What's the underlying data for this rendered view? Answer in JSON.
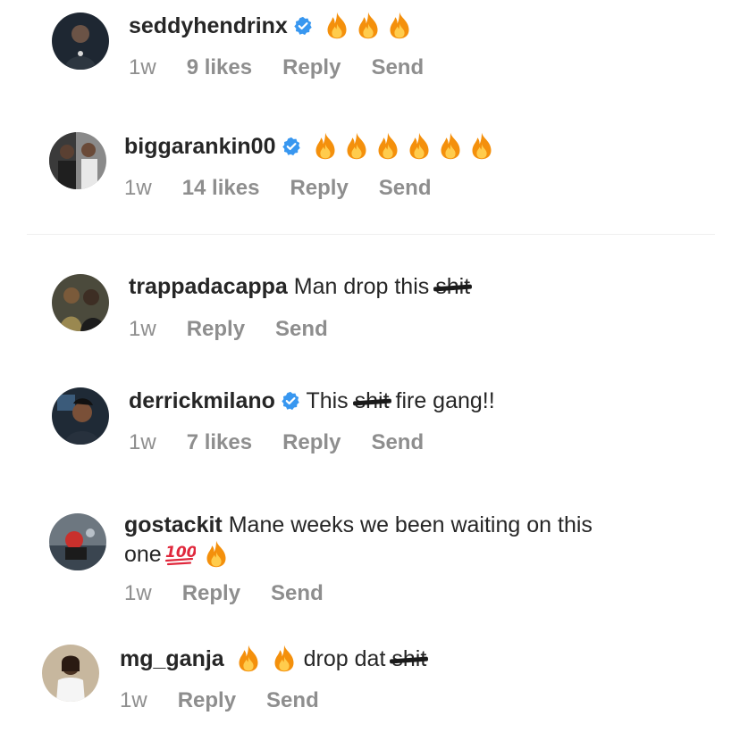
{
  "comments": [
    {
      "username": "seddyhendrinx",
      "verified": true,
      "pre_text": "",
      "censored": "",
      "post_text": "",
      "fire_count": 3,
      "time": "1w",
      "likes": "9 likes",
      "reply_label": "Reply",
      "send_label": "Send"
    },
    {
      "username": "biggarankin00",
      "verified": true,
      "fire_count": 6,
      "time": "1w",
      "likes": "14 likes",
      "reply_label": "Reply",
      "send_label": "Send"
    },
    {
      "username": "trappadacappa",
      "verified": false,
      "pre_text": "Man drop this",
      "censored": "shit",
      "time": "1w",
      "reply_label": "Reply",
      "send_label": "Send"
    },
    {
      "username": "derrickmilano",
      "verified": true,
      "pre_text": "This",
      "censored": "shit",
      "post_text": "fire gang!!",
      "time": "1w",
      "likes": "7 likes",
      "reply_label": "Reply",
      "send_label": "Send"
    },
    {
      "username": "gostackit",
      "verified": false,
      "pre_text": "Mane weeks we been waiting on this",
      "line2_text": "one",
      "emoji": [
        "hundred-points",
        "fire"
      ],
      "time": "1w",
      "reply_label": "Reply",
      "send_label": "Send"
    },
    {
      "username": "mg_ganja",
      "verified": false,
      "fire_count": 2,
      "pre_text": "drop dat",
      "censored": "shit",
      "time": "1w",
      "reply_label": "Reply",
      "send_label": "Send"
    }
  ],
  "colors": {
    "text": "#262626",
    "meta": "#8e8e8e",
    "verified": "#3897f0",
    "fire_outer": "#f4900c",
    "fire_inner": "#ffcc4d",
    "divider": "#efefef"
  }
}
